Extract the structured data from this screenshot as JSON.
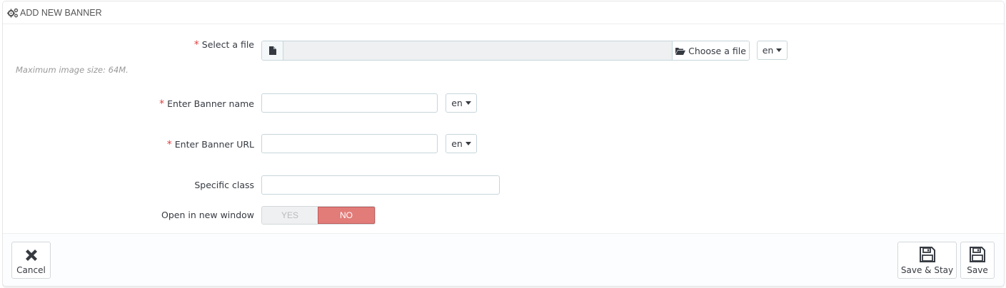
{
  "panel": {
    "title": "Add new banner"
  },
  "form": {
    "file": {
      "label": "Select a file",
      "required_mark": "*",
      "choose_label": "Choose a file",
      "lang": "en",
      "hint": "Maximum image size: 64M."
    },
    "banner_name": {
      "label": "Enter Banner name",
      "required_mark": "*",
      "value": "",
      "lang": "en"
    },
    "banner_url": {
      "label": "Enter Banner URL",
      "required_mark": "*",
      "value": "",
      "lang": "en"
    },
    "specific_class": {
      "label": "Specific class",
      "value": ""
    },
    "new_window": {
      "label": "Open in new window",
      "yes_label": "YES",
      "no_label": "NO",
      "selected": "NO"
    }
  },
  "footer": {
    "cancel_label": "Cancel",
    "save_stay_label": "Save & Stay",
    "save_label": "Save"
  },
  "colors": {
    "required": "#e33e3e",
    "toggle_no": "#e27c79"
  },
  "icons": {
    "header": "cogs-icon",
    "file": "file-icon",
    "choose": "folder-open-icon",
    "cancel": "close-icon",
    "save": "floppy-disk-icon"
  }
}
